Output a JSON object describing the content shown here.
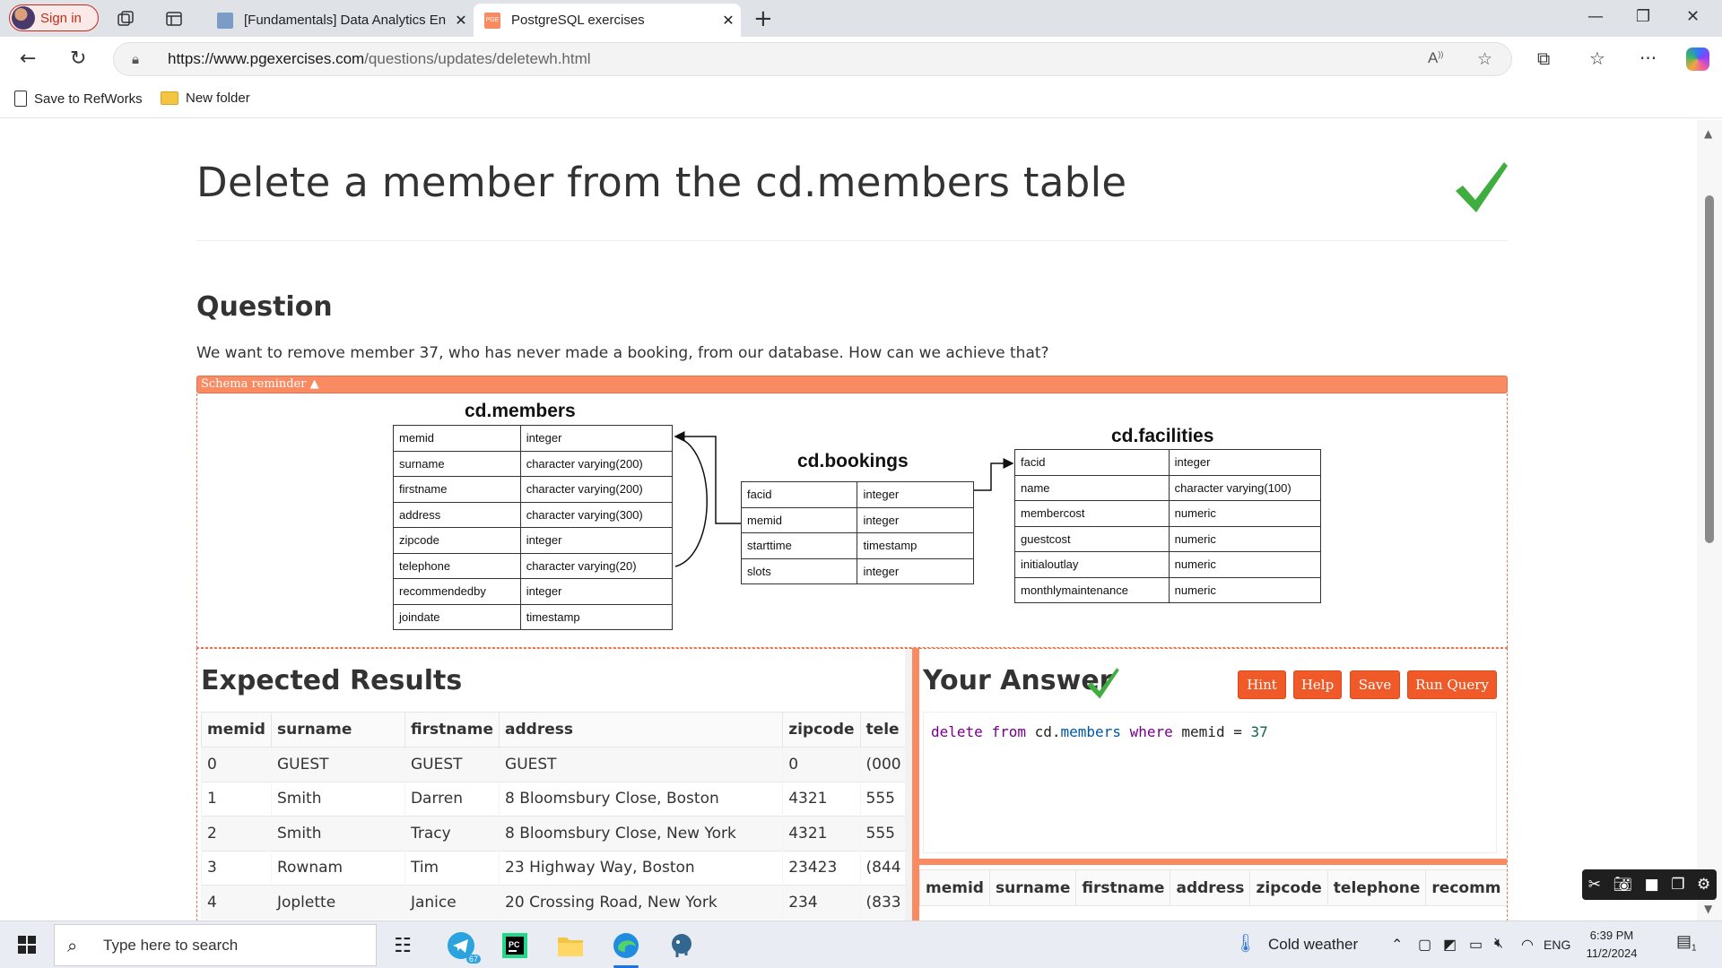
{
  "browser": {
    "signin_label": "Sign in",
    "tabs": [
      {
        "title": "[Fundamentals] Data Analytics En",
        "active": false
      },
      {
        "title": "PostgreSQL exercises",
        "active": true
      }
    ],
    "url_host": "https://www.pgexercises.com",
    "url_path": "/questions/updates/deletewh.html",
    "bookmarks": [
      {
        "label": "Save to RefWorks",
        "icon": "document-icon"
      },
      {
        "label": "New folder",
        "icon": "folder-icon"
      }
    ]
  },
  "page": {
    "title": "Delete a member from the cd.members table",
    "question_heading": "Question",
    "question_text": "We want to remove member 37, who has never made a booking, from our database. How can we achieve that?",
    "schema_toggle": "Schema reminder ▲",
    "schema": {
      "members": {
        "name": "cd.members",
        "columns": [
          [
            "memid",
            "integer"
          ],
          [
            "surname",
            "character varying(200)"
          ],
          [
            "firstname",
            "character varying(200)"
          ],
          [
            "address",
            "character varying(300)"
          ],
          [
            "zipcode",
            "integer"
          ],
          [
            "telephone",
            "character varying(20)"
          ],
          [
            "recommendedby",
            "integer"
          ],
          [
            "joindate",
            "timestamp"
          ]
        ]
      },
      "bookings": {
        "name": "cd.bookings",
        "columns": [
          [
            "facid",
            "integer"
          ],
          [
            "memid",
            "integer"
          ],
          [
            "starttime",
            "timestamp"
          ],
          [
            "slots",
            "integer"
          ]
        ]
      },
      "facilities": {
        "name": "cd.facilities",
        "columns": [
          [
            "facid",
            "integer"
          ],
          [
            "name",
            "character varying(100)"
          ],
          [
            "membercost",
            "numeric"
          ],
          [
            "guestcost",
            "numeric"
          ],
          [
            "initialoutlay",
            "numeric"
          ],
          [
            "monthlymaintenance",
            "numeric"
          ]
        ]
      }
    },
    "expected": {
      "heading": "Expected Results",
      "columns": [
        "memid",
        "surname",
        "firstname",
        "address",
        "zipcode",
        "tele"
      ],
      "rows": [
        [
          "0",
          "GUEST",
          "GUEST",
          "GUEST",
          "0",
          "(000"
        ],
        [
          "1",
          "Smith",
          "Darren",
          "8 Bloomsbury Close, Boston",
          "4321",
          "555"
        ],
        [
          "2",
          "Smith",
          "Tracy",
          "8 Bloomsbury Close, New York",
          "4321",
          "555"
        ],
        [
          "3",
          "Rownam",
          "Tim",
          "23 Highway Way, Boston",
          "23423",
          "(844"
        ],
        [
          "4",
          "Joplette",
          "Janice",
          "20 Crossing Road, New York",
          "234",
          "(833"
        ]
      ]
    },
    "answer": {
      "heading": "Your Answer",
      "buttons": {
        "hint": "Hint",
        "help": "Help",
        "save": "Save",
        "run": "Run Query"
      },
      "code": {
        "kw1": "delete",
        "kw2": "from",
        "schema": "cd",
        "dot": ".",
        "table": "members",
        "kw3": "where",
        "col": "memid",
        "op": "=",
        "num": "37"
      },
      "columns": [
        "memid",
        "surname",
        "firstname",
        "address",
        "zipcode",
        "telephone",
        "recomm"
      ]
    }
  },
  "taskbar": {
    "search_placeholder": "Type here to search",
    "weather": "Cold weather",
    "language": "ENG",
    "time": "6:39 PM",
    "date": "11/2/2024",
    "notification_count": "1",
    "telegram_badge": "67"
  }
}
